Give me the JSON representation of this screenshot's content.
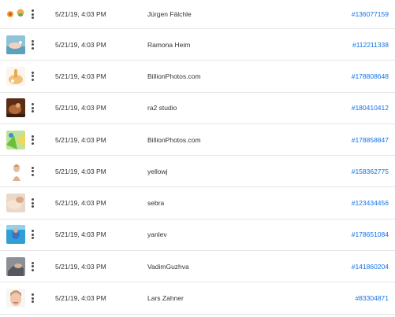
{
  "rows": [
    {
      "thumbnail": "food-thumbnail",
      "date": "5/21/19, 4:03 PM",
      "author": "Jürgen Fälchle",
      "id": "#136077159"
    },
    {
      "thumbnail": "hand-thumbnail",
      "date": "5/21/19, 4:03 PM",
      "author": "Ramona Heim",
      "id": "#112211338"
    },
    {
      "thumbnail": "spa-thumbnail",
      "date": "5/21/19, 4:03 PM",
      "author": "BillionPhotos.com",
      "id": "#178808648"
    },
    {
      "thumbnail": "massage-thumbnail",
      "date": "5/21/19, 4:03 PM",
      "author": "ra2 studio",
      "id": "#180410412"
    },
    {
      "thumbnail": "leaves-thumbnail",
      "date": "5/21/19, 4:03 PM",
      "author": "BillionPhotos.com",
      "id": "#178858847"
    },
    {
      "thumbnail": "woman-thumbnail",
      "date": "5/21/19, 4:03 PM",
      "author": "yellowj",
      "id": "#158362775"
    },
    {
      "thumbnail": "care-thumbnail",
      "date": "5/21/19, 4:03 PM",
      "author": "sebra",
      "id": "#123434456"
    },
    {
      "thumbnail": "pool-thumbnail",
      "date": "5/21/19, 4:03 PM",
      "author": "yanlev",
      "id": "#178651084"
    },
    {
      "thumbnail": "stretch-thumbnail",
      "date": "5/21/19, 4:03 PM",
      "author": "VadimGuzhva",
      "id": "#141860204"
    },
    {
      "thumbnail": "face-thumbnail",
      "date": "5/21/19, 4:03 PM",
      "author": "Lars Zahner",
      "id": "#83304871"
    }
  ],
  "colors": {
    "link": "#1473e6",
    "text": "#323232",
    "divider": "#e4e4e4"
  }
}
